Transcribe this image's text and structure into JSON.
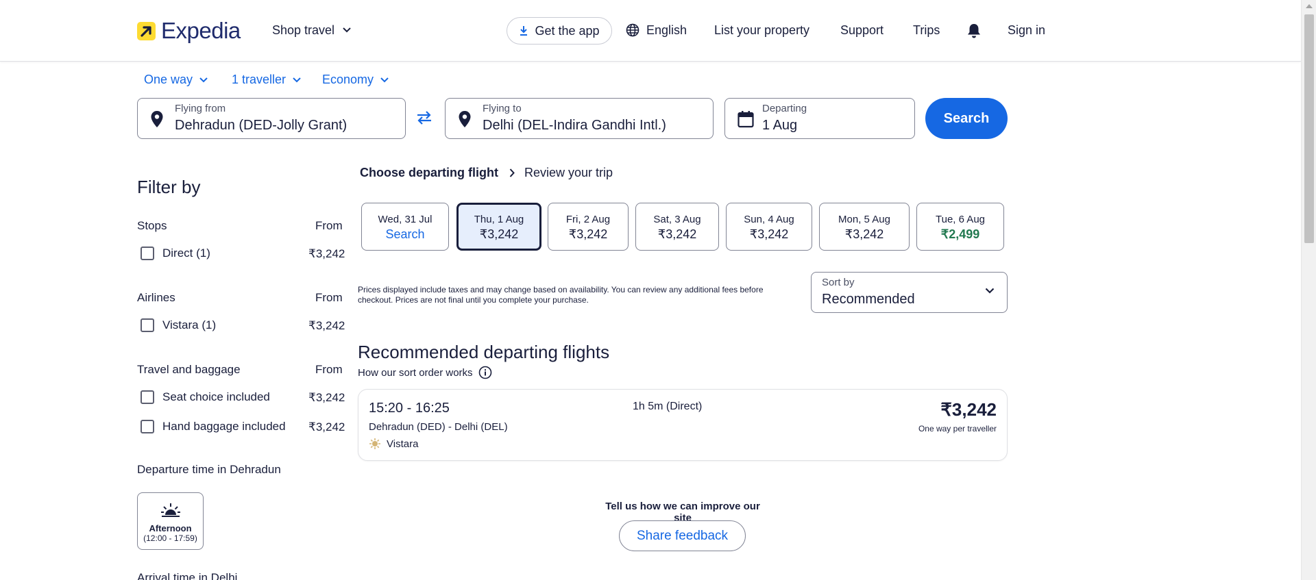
{
  "header": {
    "logo_text": "Expedia",
    "shop_travel": "Shop travel",
    "get_app": "Get the app",
    "language": "English",
    "list_property": "List your property",
    "support": "Support",
    "trips": "Trips",
    "sign_in": "Sign in"
  },
  "search": {
    "trip_type": "One way",
    "travellers": "1 traveller",
    "cabin": "Economy",
    "from_label": "Flying from",
    "from_value": "Dehradun (DED-Jolly Grant)",
    "to_label": "Flying to",
    "to_value": "Delhi (DEL-Indira Gandhi Intl.)",
    "date_label": "Departing",
    "date_value": "1 Aug",
    "button": "Search"
  },
  "filters": {
    "title": "Filter by",
    "from_label": "From",
    "stops": {
      "title": "Stops",
      "options": [
        {
          "label": "Direct (1)",
          "price": "₹3,242"
        }
      ]
    },
    "airlines": {
      "title": "Airlines",
      "options": [
        {
          "label": "Vistara (1)",
          "price": "₹3,242"
        }
      ]
    },
    "travel": {
      "title": "Travel and baggage",
      "options": [
        {
          "label": "Seat choice included",
          "price": "₹3,242"
        },
        {
          "label": "Hand baggage included",
          "price": "₹3,242"
        }
      ]
    },
    "departure_title": "Departure time in Dehradun",
    "departure_card": {
      "name": "Afternoon",
      "range": "(12:00 - 17:59)"
    },
    "arrival_title": "Arrival time in Delhi"
  },
  "breadcrumb": {
    "current": "Choose departing flight",
    "next": "Review your trip"
  },
  "dates": [
    {
      "day": "Wed, 31 Jul",
      "price": "Search"
    },
    {
      "day": "Thu, 1 Aug",
      "price": "₹3,242"
    },
    {
      "day": "Fri, 2 Aug",
      "price": "₹3,242"
    },
    {
      "day": "Sat, 3 Aug",
      "price": "₹3,242"
    },
    {
      "day": "Sun, 4 Aug",
      "price": "₹3,242"
    },
    {
      "day": "Mon, 5 Aug",
      "price": "₹3,242"
    },
    {
      "day": "Tue, 6 Aug",
      "price": "₹2,499"
    }
  ],
  "disclaimer": "Prices displayed include taxes and may change based on availability. You can review any additional fees before checkout. Prices are not final until you complete your purchase.",
  "sort": {
    "label": "Sort by",
    "value": "Recommended"
  },
  "results": {
    "title": "Recommended departing flights",
    "how_sort": "How our sort order works",
    "flights": [
      {
        "times": "15:20 - 16:25",
        "duration": "1h 5m (Direct)",
        "route": "Dehradun (DED) - Delhi (DEL)",
        "airline": "Vistara",
        "price": "₹3,242",
        "price_note": "One way per traveller"
      }
    ]
  },
  "feedback": {
    "question": "Tell us how we can improve our site",
    "button": "Share feedback"
  },
  "colors": {
    "brand_blue": "#1668e3",
    "navy": "#191e3b",
    "logo_yellow": "#fddb32",
    "deal_green": "#227950"
  }
}
